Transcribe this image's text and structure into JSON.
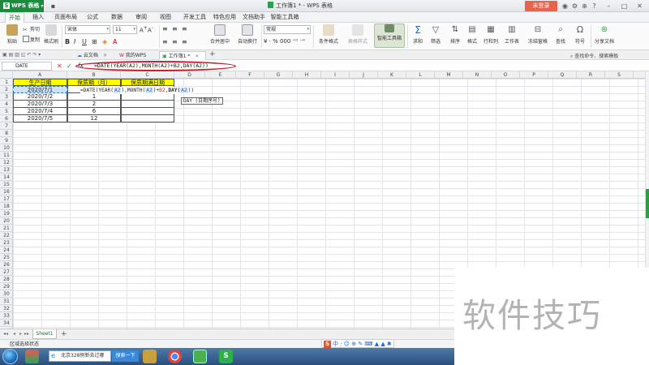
{
  "app": {
    "app_button_label": "WPS 表格",
    "document_title": "工作簿1 * - WPS 表格",
    "login_button_label": "未登录"
  },
  "ribbon_tabs": [
    "开始",
    "插入",
    "页面布局",
    "公式",
    "数据",
    "审阅",
    "视图",
    "开发工具",
    "特色应用",
    "文档助手",
    "智能工具箱"
  ],
  "active_ribbon_tab": "开始",
  "ribbon": {
    "cut_label": "剪切",
    "copy_label": "复制",
    "paste_label": "粘贴",
    "format_painter_label": "格式刷",
    "font_name": "宋体",
    "font_size": "11",
    "merge_center_label": "合并居中",
    "auto_wrap_label": "自动换行",
    "number_format": "常规",
    "conditional_format_label": "条件格式",
    "table_style_label": "表格样式",
    "smart_toolbox_label": "智能工具箱",
    "sum_label": "求和",
    "filter_label": "筛选",
    "sort_label": "排序",
    "format_label": "格式",
    "rows_cols_label": "行和列",
    "worksheet_label": "工作表",
    "freeze_panes_label": "冻结窗格",
    "find_label": "查找",
    "symbol_label": "符号",
    "share_doc_label": "分享文档",
    "search_commands_label": "查找命令、搜索模板"
  },
  "document_tabs": [
    {
      "label": "云文档"
    },
    {
      "label": "我的WPS"
    },
    {
      "label": "工作簿1 *"
    }
  ],
  "formula_bar": {
    "name_box": "DATE",
    "cancel_symbol": "✕",
    "confirm_symbol": "✓",
    "fx_symbol": "fx",
    "formula": "=DATE(YEAR(A2),MONTH(A2)+B2,DAY(A2))"
  },
  "columns": [
    "A",
    "B",
    "C",
    "D",
    "E",
    "F",
    "G",
    "H",
    "I",
    "J",
    "K",
    "L",
    "M",
    "N",
    "O",
    "P",
    "Q",
    "R",
    "S"
  ],
  "row_numbers": [
    "1",
    "2",
    "3",
    "4",
    "5",
    "6",
    "7",
    "8",
    "9",
    "10",
    "11",
    "12",
    "13",
    "14",
    "15",
    "16",
    "17",
    "18",
    "19",
    "20",
    "21",
    "22",
    "23",
    "24",
    "25",
    "26",
    "27",
    "28",
    "29",
    "30",
    "31",
    "32",
    "33",
    "34"
  ],
  "table": {
    "headers": [
      "生产日期",
      "保质期（月）",
      "保质期满日期"
    ],
    "rows": [
      [
        "2020/7/1",
        "",
        ""
      ],
      [
        "2020/7/2",
        "1",
        ""
      ],
      [
        "2020/7/3",
        "2",
        ""
      ],
      [
        "2020/7/4",
        "6",
        ""
      ],
      [
        "2020/7/5",
        "12",
        ""
      ]
    ]
  },
  "editing": {
    "formula_part1": "=DATE(YEAR(",
    "ref_a2_1": "A2",
    "formula_part2": "),MONTH(",
    "ref_a2_2": "A2",
    "formula_part3": ")+",
    "ref_b2": "B2",
    "formula_part4": ",",
    "formula_part5": "DAY(",
    "ref_a2_3": "A2",
    "formula_part6": "))",
    "tooltip": "DAY (日期序号)"
  },
  "sheet_tabs": [
    "Sheet1"
  ],
  "status_bar": {
    "status": "区域选择状态"
  },
  "taskbar": {
    "search_text": "北京328例新去过哪",
    "search_button": "搜索一下"
  },
  "watermark": "软件技巧",
  "colors": {
    "wps_green": "#1d8a3d",
    "login_red": "#e8624c",
    "header_yellow": "#ffff00",
    "highlight_ellipse": "#c0222b",
    "selection_blue": "#2a6fb5"
  },
  "icons": [
    "wps-logo-icon",
    "document-icon",
    "cut-icon",
    "copy-icon",
    "paste-icon",
    "format-painter-icon",
    "sum-icon",
    "filter-icon",
    "sort-icon",
    "find-icon",
    "symbol-icon",
    "share-icon",
    "cloud-icon",
    "wps-home-icon",
    "close-icon",
    "add-sheet-icon",
    "start-orb-icon",
    "sogou-ime-icon"
  ]
}
